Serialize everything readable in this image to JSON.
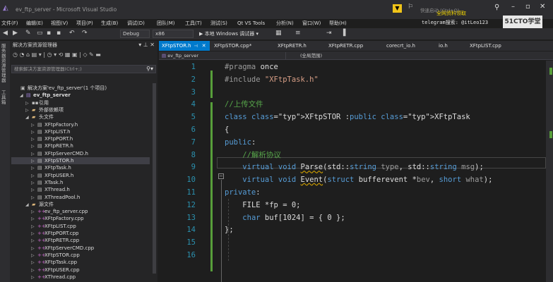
{
  "titlebar": {
    "app_title": "ev_ftp_server - Microsoft Visual Studio",
    "quick_launch": "快速启动 (Ctrl+Q)",
    "overlay_yellow": "全网资料领取",
    "overlay_white": "telegram搜索: @itLeo123",
    "brand": "51CTO学堂",
    "notify_icon_name": "notification-flag-icon"
  },
  "menu": {
    "items": [
      "文件(F)",
      "编辑(E)",
      "视图(V)",
      "项目(P)",
      "生成(B)",
      "调试(D)",
      "团队(M)",
      "工具(T)",
      "测试(S)",
      "Qt VS Tools",
      "分析(N)",
      "窗口(W)",
      "帮助(H)"
    ]
  },
  "toolbar": {
    "config": "Debug",
    "platform": "x86",
    "run_label": "▶ 本地 Windows 调试器 ▾"
  },
  "sidestrip": {
    "labels": [
      "服务器资源管理器",
      "工具箱"
    ]
  },
  "solution_explorer": {
    "title": "解决方案资源管理器",
    "search_placeholder": "搜索解决方案资源管理器(Ctrl+;)",
    "rows": [
      {
        "label": "解决方案'ev_ftp_server'(1 个项目)",
        "icon": "sln",
        "indent": 0,
        "expander": ""
      },
      {
        "label": "ev_ftp_server",
        "icon": "proj",
        "indent": 1,
        "expander": "◢",
        "bold": true
      },
      {
        "label": "引用",
        "icon": "ref",
        "indent": 2,
        "expander": "▷"
      },
      {
        "label": "外部依赖项",
        "icon": "folder",
        "indent": 2,
        "expander": "▷"
      },
      {
        "label": "头文件",
        "icon": "folder",
        "indent": 2,
        "expander": "◢"
      },
      {
        "label": "XFtpFactory.h",
        "icon": "h",
        "indent": 3,
        "expander": "▷"
      },
      {
        "label": "XFtpLIST.h",
        "icon": "h",
        "indent": 3,
        "expander": "▷"
      },
      {
        "label": "XFtpPORT.h",
        "icon": "h",
        "indent": 3,
        "expander": "▷"
      },
      {
        "label": "XFtpRETR.h",
        "icon": "h",
        "indent": 3,
        "expander": "▷"
      },
      {
        "label": "XFtpServerCMD.h",
        "icon": "h",
        "indent": 3,
        "expander": "▷"
      },
      {
        "label": "XFtpSTOR.h",
        "icon": "h",
        "indent": 3,
        "expander": "▷",
        "selected": true
      },
      {
        "label": "XFtpTask.h",
        "icon": "h",
        "indent": 3,
        "expander": "▷"
      },
      {
        "label": "XFtpUSER.h",
        "icon": "h",
        "indent": 3,
        "expander": "▷"
      },
      {
        "label": "XTask.h",
        "icon": "h",
        "indent": 3,
        "expander": "▷"
      },
      {
        "label": "XThread.h",
        "icon": "h",
        "indent": 3,
        "expander": "▷"
      },
      {
        "label": "XThreadPool.h",
        "icon": "h",
        "indent": 3,
        "expander": "▷"
      },
      {
        "label": "源文件",
        "icon": "folder",
        "indent": 2,
        "expander": "◢"
      },
      {
        "label": "ev_ftp_server.cpp",
        "icon": "cpp",
        "indent": 3,
        "expander": "▷"
      },
      {
        "label": "XFtpFactory.cpp",
        "icon": "cpp",
        "indent": 3,
        "expander": "▷"
      },
      {
        "label": "XFtpLIST.cpp",
        "icon": "cpp",
        "indent": 3,
        "expander": "▷"
      },
      {
        "label": "XFtpPORT.cpp",
        "icon": "cpp",
        "indent": 3,
        "expander": "▷"
      },
      {
        "label": "XFtpRETR.cpp",
        "icon": "cpp",
        "indent": 3,
        "expander": "▷"
      },
      {
        "label": "XFtpServerCMD.cpp",
        "icon": "cpp",
        "indent": 3,
        "expander": "▷"
      },
      {
        "label": "XFtpSTOR.cpp",
        "icon": "cpp",
        "indent": 3,
        "expander": "▷"
      },
      {
        "label": "XFtpTask.cpp",
        "icon": "cpp",
        "indent": 3,
        "expander": "▷"
      },
      {
        "label": "XFtpUSER.cpp",
        "icon": "cpp",
        "indent": 3,
        "expander": "▷"
      },
      {
        "label": "XThread.cpp",
        "icon": "cpp",
        "indent": 3,
        "expander": "▷"
      }
    ]
  },
  "editor": {
    "tabs": [
      {
        "label": "XFtpSTOR.h",
        "active": true
      },
      {
        "label": "XFtpSTOR.cpp*",
        "active": false
      },
      {
        "label": "XFtpRETR.h",
        "active": false
      },
      {
        "label": "XFtpRETR.cpp",
        "active": false
      },
      {
        "label": "corecrt_io.h",
        "active": false
      },
      {
        "label": "io.h",
        "active": false
      },
      {
        "label": "XFtpLIST.cpp",
        "active": false
      }
    ],
    "nav_left": "ev_ftp_server",
    "nav_mid": "(全局范围)",
    "line_numbers": [
      "1",
      "2",
      "3",
      "4",
      "5",
      "6",
      "7",
      "8",
      "9",
      "10",
      "11",
      "12",
      "13",
      "14",
      "15",
      "16"
    ],
    "lines": [
      "#pragma once",
      "#include \"XFtpTask.h\"",
      "",
      "//上传文件",
      "class XFtpSTOR :public XFtpTask",
      "{",
      "public:",
      "    //解析协议",
      "    virtual void Parse(std::string type, std::string msg);",
      "    virtual void Event(struct bufferevent *bev, short what);",
      "private:",
      "    FILE *fp = 0;",
      "    char buf[1024] = { 0 };",
      "};",
      "",
      ""
    ],
    "change_bar_color": "#579e3a",
    "accent_color": "#007acc"
  }
}
